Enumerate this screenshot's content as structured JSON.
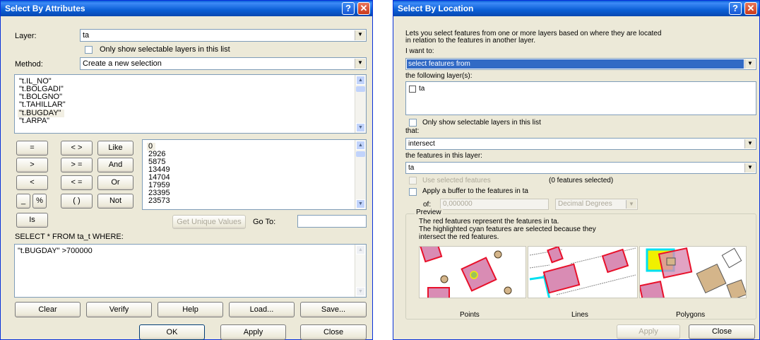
{
  "attr": {
    "title": "Select By Attributes",
    "help_glyph": "?",
    "close_glyph": "✕",
    "layer_label": "Layer:",
    "layer_value": "ta",
    "only_selectable_label": "Only show selectable layers in this list",
    "method_label": "Method:",
    "method_value": "Create a new selection",
    "fields": [
      "\"t.IL_NO\"",
      "\"t.BOLGADI\"",
      "\"t.BOLGNO\"",
      "\"t.TAHILLAR\"",
      "\"t.BUGDAY\"",
      "\"t.ARPA\""
    ],
    "selected_field": "\"t.BUGDAY\"",
    "ops": {
      "eq": "=",
      "ne": "< >",
      "like": "Like",
      "gt": ">",
      "ge": "> =",
      "and": "And",
      "lt": "<",
      "le": "< =",
      "or": "Or",
      "us": "_",
      "pct": "%",
      "paren": "( )",
      "not": "Not",
      "is": "Is"
    },
    "values": [
      "0",
      "2926",
      "5875",
      "13449",
      "14704",
      "17959",
      "23395",
      "23573"
    ],
    "get_unique_label": "Get Unique Values",
    "goto_label": "Go To:",
    "goto_value": "",
    "sql_prefix": "SELECT * FROM ta_t WHERE:",
    "expression": "\"t.BUGDAY\" >700000",
    "clear_label": "Clear",
    "verify_label": "Verify",
    "help_label": "Help",
    "load_label": "Load...",
    "save_label": "Save...",
    "ok_label": "OK",
    "apply_label": "Apply",
    "close_label": "Close"
  },
  "loc": {
    "title": "Select By Location",
    "help_glyph": "?",
    "close_glyph": "✕",
    "intro_line1": "Lets you select features from one or more layers based on where they are located",
    "intro_line2": "in relation to the features in another layer.",
    "i_want_label": "I want to:",
    "i_want_value": "select features from",
    "following_layers_label": "the following layer(s):",
    "layers": [
      {
        "name": "ta",
        "checked": false
      }
    ],
    "only_selectable_label": "Only show selectable layers in this list",
    "that_label": "that:",
    "that_value": "intersect",
    "features_layer_label": "the features in this layer:",
    "features_layer_value": "ta",
    "use_selected_label": "Use selected features",
    "features_selected": "(0 features selected)",
    "buffer_label": "Apply a buffer to the features in  ta",
    "of_label": "of:",
    "buffer_value": "0,000000",
    "units_value": "Decimal Degrees",
    "preview_label": "Preview",
    "preview_line1": "The red features represent the features in ta.",
    "preview_line2": "The highlighted cyan features are selected because they",
    "preview_line3": "intersect the red features.",
    "preview_points": "Points",
    "preview_lines": "Lines",
    "preview_polygons": "Polygons",
    "apply_label": "Apply",
    "close_label": "Close"
  },
  "colors": {
    "title_blue": "#0b5fd6",
    "selection_blue": "#316ac5",
    "red_feature": "#e8102a",
    "red_fill": "#d98cb4",
    "cyan": "#00e0f0",
    "yellow": "#f0f000",
    "tan": "#d4b58a"
  }
}
